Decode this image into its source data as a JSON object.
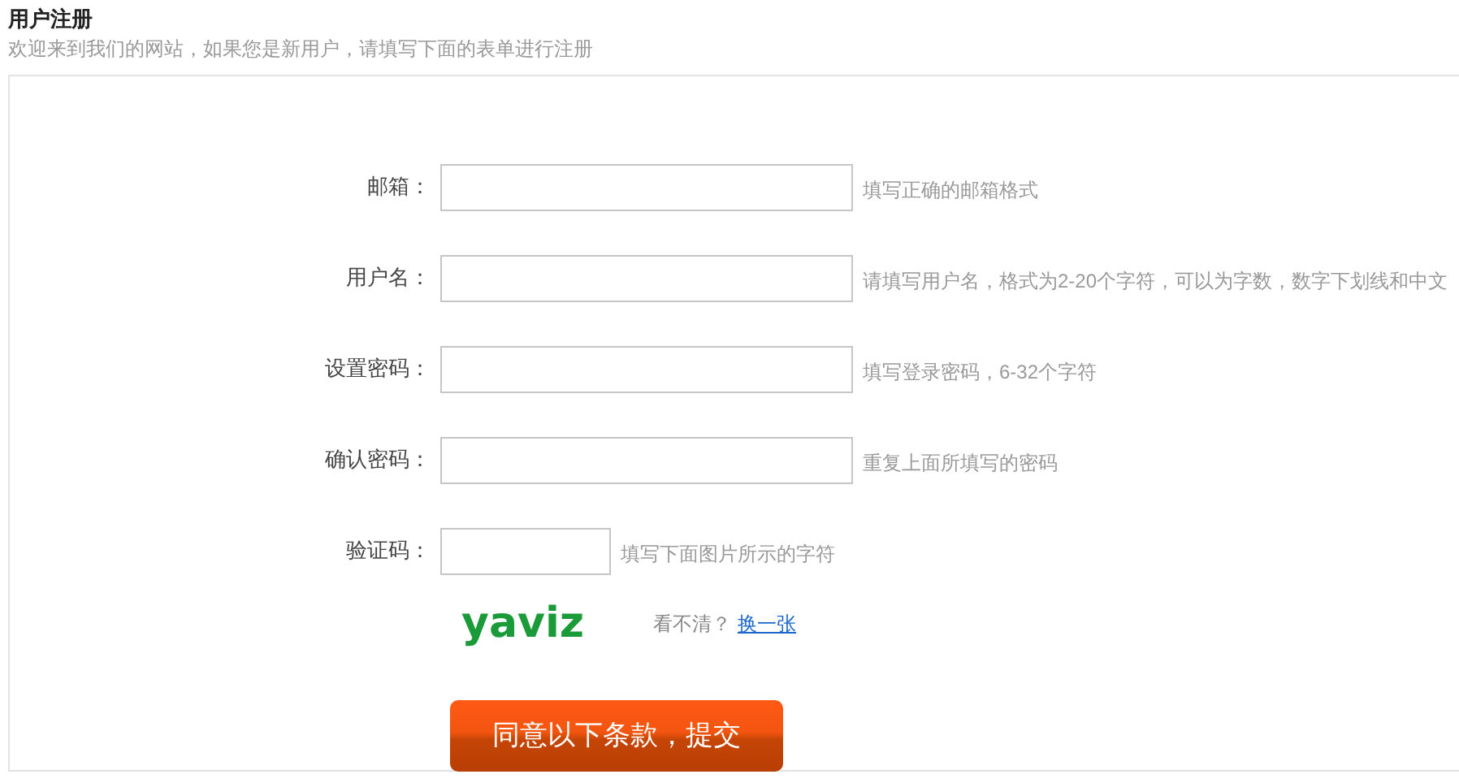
{
  "header": {
    "title": "用户注册",
    "subtitle": "欢迎来到我们的网站，如果您是新用户，请填写下面的表单进行注册"
  },
  "fields": [
    {
      "kind": "text",
      "label": "邮箱：",
      "hint": "填写正确的邮箱格式"
    },
    {
      "kind": "text",
      "label": "用户名：",
      "hint": "请填写用户名，格式为2-20个字符，可以为字数，数字下划线和中文"
    },
    {
      "kind": "password",
      "label": "设置密码：",
      "hint": "填写登录密码，6-32个字符"
    },
    {
      "kind": "password",
      "label": "确认密码：",
      "hint": "重复上面所填写的密码"
    },
    {
      "kind": "captcha",
      "label": "验证码：",
      "hint": "填写下面图片所示的字符"
    }
  ],
  "captcha": {
    "code": "yaviz",
    "question": "看不清？",
    "refresh_link": "换一张"
  },
  "submit_button": "同意以下条款，提交"
}
